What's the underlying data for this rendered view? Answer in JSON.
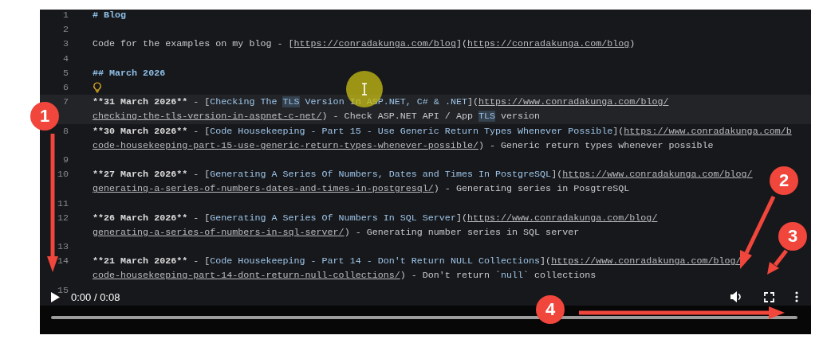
{
  "editor": {
    "lines": [
      {
        "number": "1",
        "kind": "text",
        "current": false,
        "rows": [
          {
            "parts": [
              {
                "kind": "heading",
                "text": "# Blog"
              }
            ]
          }
        ]
      },
      {
        "number": "2",
        "kind": "text",
        "current": false,
        "rows": [
          {
            "parts": []
          }
        ]
      },
      {
        "number": "3",
        "kind": "text",
        "current": false,
        "rows": [
          {
            "parts": [
              {
                "kind": "plain",
                "text": "Code for the examples on my blog - ["
              },
              {
                "kind": "url",
                "text": "https://conradakunga.com/blog"
              },
              {
                "kind": "plain",
                "text": "]("
              },
              {
                "kind": "url",
                "text": "https://conradakunga.com/blog"
              },
              {
                "kind": "plain",
                "text": ")"
              }
            ]
          }
        ]
      },
      {
        "number": "4",
        "kind": "text",
        "current": false,
        "rows": [
          {
            "parts": []
          }
        ]
      },
      {
        "number": "5",
        "kind": "text",
        "current": false,
        "rows": [
          {
            "parts": [
              {
                "kind": "heading",
                "text": "## March 2026"
              }
            ]
          }
        ]
      },
      {
        "number": "6",
        "kind": "lightbulb",
        "current": false,
        "rows": [
          {
            "parts": []
          }
        ]
      },
      {
        "number": "7",
        "kind": "text",
        "current": true,
        "rows": [
          {
            "parts": [
              {
                "kind": "bold",
                "text": "**31 March 2026**"
              },
              {
                "kind": "plain",
                "text": " - ["
              },
              {
                "kind": "title",
                "text": "Checking The "
              },
              {
                "kind": "match",
                "text": "TLS"
              },
              {
                "kind": "title",
                "text": " Version In ASP.NET, C# & .NET"
              },
              {
                "kind": "plain",
                "text": "]("
              },
              {
                "kind": "url",
                "text": "https://www.conradakunga.com/blog/"
              }
            ]
          },
          {
            "parts": [
              {
                "kind": "url",
                "text": "checking-the-tls-version-in-aspnet-c-net/"
              },
              {
                "kind": "plain",
                "text": ") - Check ASP.NET API / App "
              },
              {
                "kind": "match",
                "text": "TLS"
              },
              {
                "kind": "plain",
                "text": " version"
              }
            ]
          }
        ]
      },
      {
        "number": "8",
        "kind": "text",
        "current": false,
        "rows": [
          {
            "parts": [
              {
                "kind": "bold",
                "text": "**30 March 2026**"
              },
              {
                "kind": "plain",
                "text": " - ["
              },
              {
                "kind": "title",
                "text": "Code Housekeeping - Part 15 - Use Generic Return Types Whenever Possible"
              },
              {
                "kind": "plain",
                "text": "]("
              },
              {
                "kind": "url",
                "text": "https://www.conradakunga.com/b"
              }
            ]
          },
          {
            "parts": [
              {
                "kind": "url",
                "text": "code-housekeeping-part-15-use-generic-return-types-whenever-possible/"
              },
              {
                "kind": "plain",
                "text": ") - Generic return types whenever possible"
              }
            ]
          }
        ]
      },
      {
        "number": "9",
        "kind": "text",
        "current": false,
        "rows": [
          {
            "parts": []
          }
        ]
      },
      {
        "number": "10",
        "kind": "text",
        "current": false,
        "rows": [
          {
            "parts": [
              {
                "kind": "bold",
                "text": "**27 March 2026**"
              },
              {
                "kind": "plain",
                "text": " - ["
              },
              {
                "kind": "title",
                "text": "Generating A Series Of Numbers, Dates and Times In PostgreSQL"
              },
              {
                "kind": "plain",
                "text": "]("
              },
              {
                "kind": "url",
                "text": "https://www.conradakunga.com/blog/"
              }
            ]
          },
          {
            "parts": [
              {
                "kind": "url",
                "text": "generating-a-series-of-numbers-dates-and-times-in-postgresql/"
              },
              {
                "kind": "plain",
                "text": ") - Generating series in PosgtreSQL"
              }
            ]
          }
        ]
      },
      {
        "number": "11",
        "kind": "text",
        "current": false,
        "rows": [
          {
            "parts": []
          }
        ]
      },
      {
        "number": "12",
        "kind": "text",
        "current": false,
        "rows": [
          {
            "parts": [
              {
                "kind": "bold",
                "text": "**26 March 2026**"
              },
              {
                "kind": "plain",
                "text": " - ["
              },
              {
                "kind": "title",
                "text": "Generating A Series Of Numbers In SQL Server"
              },
              {
                "kind": "plain",
                "text": "]("
              },
              {
                "kind": "url",
                "text": "https://www.conradakunga.com/blog/"
              }
            ]
          },
          {
            "parts": [
              {
                "kind": "url",
                "text": "generating-a-series-of-numbers-in-sql-server/"
              },
              {
                "kind": "plain",
                "text": ") - Generating number series in SQL server"
              }
            ]
          }
        ]
      },
      {
        "number": "13",
        "kind": "text",
        "current": false,
        "rows": [
          {
            "parts": []
          }
        ]
      },
      {
        "number": "14",
        "kind": "text",
        "current": false,
        "rows": [
          {
            "parts": [
              {
                "kind": "bold",
                "text": "**21 March 2026**"
              },
              {
                "kind": "plain",
                "text": " - ["
              },
              {
                "kind": "title",
                "text": "Code Housekeeping - Part 14 - Don't Return NULL Collections"
              },
              {
                "kind": "plain",
                "text": "]("
              },
              {
                "kind": "url",
                "text": "https://www.conradakunga.com/blog/"
              }
            ]
          },
          {
            "parts": [
              {
                "kind": "url",
                "text": "code-housekeeping-part-14-dont-return-null-collections/"
              },
              {
                "kind": "plain",
                "text": ") - Don't return `"
              },
              {
                "kind": "title",
                "text": "null"
              },
              {
                "kind": "plain",
                "text": "` collections"
              }
            ]
          }
        ]
      },
      {
        "number": "15",
        "kind": "text",
        "current": false,
        "rows": [
          {
            "parts": []
          }
        ]
      }
    ]
  },
  "player": {
    "time": "0:00 / 0:08"
  },
  "annotations": [
    {
      "label": "1"
    },
    {
      "label": "2"
    },
    {
      "label": "3"
    },
    {
      "label": "4"
    }
  ]
}
